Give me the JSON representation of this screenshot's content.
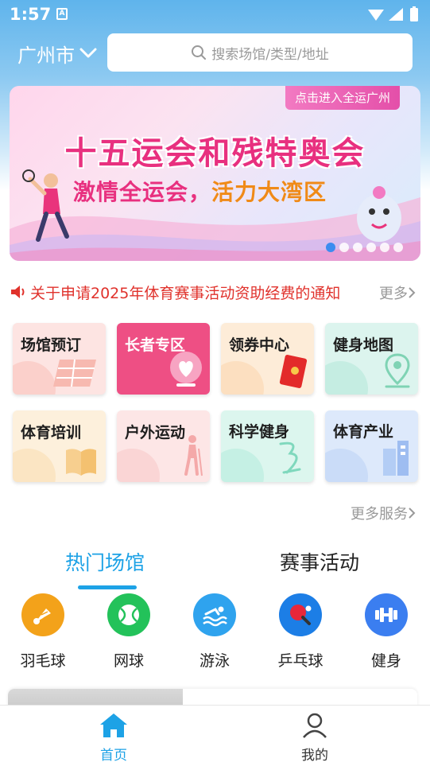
{
  "status_bar": {
    "time": "1:57",
    "notification_icon": "A"
  },
  "header": {
    "city": "广州市",
    "search_placeholder": "搜索场馆/类型/地址"
  },
  "banner": {
    "tag": "点击进入全运广州",
    "title": "十五运会和残特奥会",
    "subtitle_part1": "激情全运会，",
    "subtitle_part2": "活力大湾区",
    "page_count": 6,
    "active_page": 1
  },
  "notice": {
    "text": "关于申请2025年体育赛事活动资助经费的通知",
    "more": "更多"
  },
  "services": [
    {
      "label": "场馆预订",
      "icon": "court-icon",
      "bg": "#fde4e2"
    },
    {
      "label": "长者专区",
      "icon": "heart-hand-icon",
      "bg": "#ee4f84"
    },
    {
      "label": "领券中心",
      "icon": "red-packet-icon",
      "bg": "#fdecd8"
    },
    {
      "label": "健身地图",
      "icon": "map-pin-icon",
      "bg": "#dcf4ee"
    },
    {
      "label": "体育培训",
      "icon": "book-icon",
      "bg": "#fdf0dc"
    },
    {
      "label": "户外运动",
      "icon": "hiker-icon",
      "bg": "#fde6e6"
    },
    {
      "label": "科学健身",
      "icon": "fitness-icon",
      "bg": "#dcf6ee"
    },
    {
      "label": "体育产业",
      "icon": "building-icon",
      "bg": "#dde9fb"
    }
  ],
  "more_services": "更多服务",
  "tabs": [
    {
      "label": "热门场馆",
      "active": true
    },
    {
      "label": "赛事活动",
      "active": false
    }
  ],
  "sports": [
    {
      "label": "羽毛球",
      "icon": "badminton-icon",
      "color": "#f3a21a"
    },
    {
      "label": "网球",
      "icon": "tennis-icon",
      "color": "#23c25a"
    },
    {
      "label": "游泳",
      "icon": "swimming-icon",
      "color": "#2fa3ee"
    },
    {
      "label": "乒乓球",
      "icon": "table-tennis-icon",
      "color": "#1c7ee6"
    },
    {
      "label": "健身",
      "icon": "dumbbell-icon",
      "color": "#3b7ef0"
    }
  ],
  "bottom_nav": [
    {
      "label": "首页",
      "icon": "home-icon",
      "active": true
    },
    {
      "label": "我的",
      "icon": "user-icon",
      "active": false
    }
  ],
  "colors": {
    "accent": "#1da2e6",
    "notice_red": "#e0322c"
  }
}
